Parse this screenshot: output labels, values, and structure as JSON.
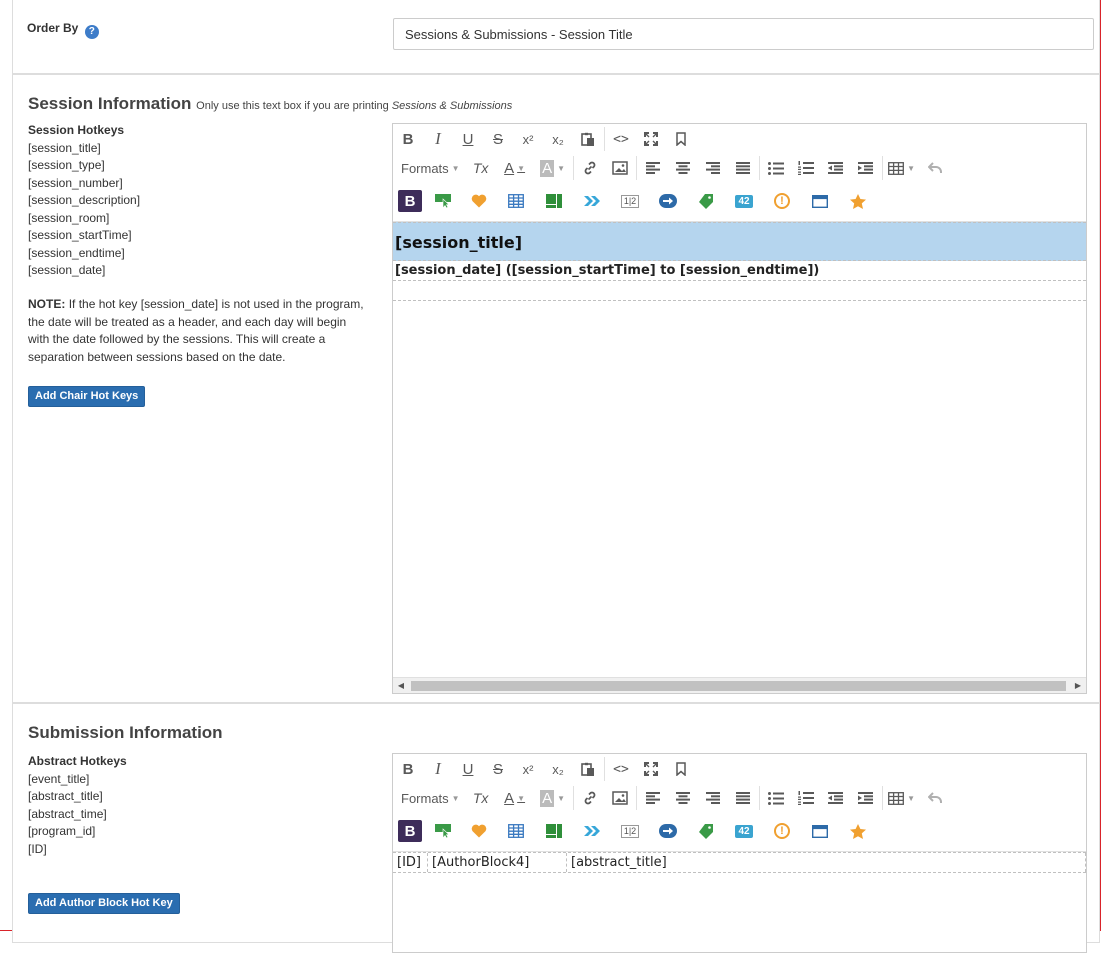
{
  "order_by": {
    "label": "Order By",
    "help": "?",
    "selected": "Sessions & Submissions - Session Title"
  },
  "session": {
    "title": "Session Information",
    "note_prefix": "Only use this text box if you are printing",
    "note_emphasis": "Sessions & Submissions",
    "hotkeys_title": "Session Hotkeys",
    "hotkeys": [
      "[session_title]",
      "[session_type]",
      "[session_number]",
      "[session_description]",
      "[session_room]",
      "[session_startTime]",
      "[session_endtime]",
      "[session_date]"
    ],
    "note_label": "NOTE:",
    "note_text": "If the hot key [session_date] is not used in the program, the date will be treated as a header, and each day will begin with the date followed by the sessions. This will create a separation between sessions based on the date.",
    "add_button": "Add Chair Hot Keys",
    "editor_title": "[session_title]",
    "editor_date_line": "[session_date] ([session_startTime] to [session_endtime])"
  },
  "submission": {
    "title": "Submission Information",
    "hotkeys_title": "Abstract Hotkeys",
    "hotkeys": [
      "[event_title]",
      "[abstract_title]",
      "[abstract_time]",
      "[program_id]",
      "[ID]"
    ],
    "add_button": "Add Author Block Hot Key",
    "cells": [
      "[ID]",
      "[AuthorBlock4]",
      "[abstract_title]"
    ]
  },
  "toolbar": {
    "formats": "Formats",
    "bold": "B",
    "italic": "I",
    "underline": "U",
    "strike": "S",
    "superscript": "x²",
    "subscript": "x₂",
    "source": "<>",
    "font_color": "A",
    "bg_color": "A",
    "clear": "Tx",
    "badge_42": "42",
    "badge_12": "1|2",
    "badge_excl": "!",
    "b_dark": "B"
  },
  "colors": {
    "primary_button": "#2a6db0",
    "title_highlight": "#b5d5ee",
    "help_icon": "#3d7cc9",
    "right_border": "#d9232a"
  }
}
